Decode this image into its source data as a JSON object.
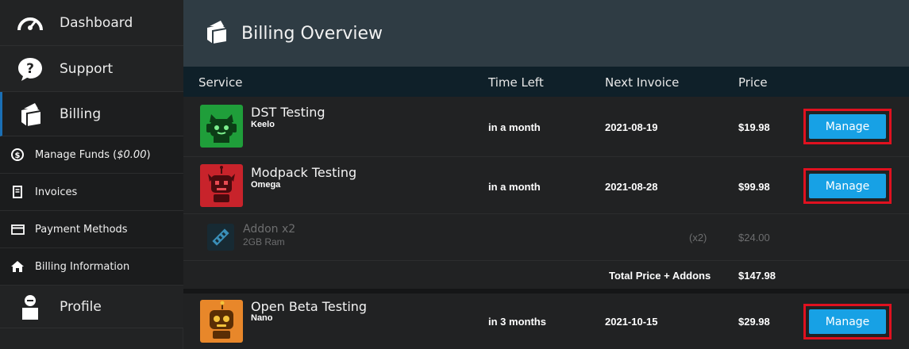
{
  "sidebar": {
    "dashboard": "Dashboard",
    "support": "Support",
    "billing": "Billing",
    "manage_funds": "Manage Funds (",
    "manage_funds_amount": "$0.00",
    "manage_funds_close": ")",
    "invoices": "Invoices",
    "payment_methods": "Payment Methods",
    "billing_information": "Billing Information",
    "profile": "Profile"
  },
  "header": {
    "title": "Billing Overview"
  },
  "table": {
    "columns": [
      "Service",
      "Time Left",
      "Next Invoice",
      "Price"
    ],
    "rows": [
      {
        "name": "DST Testing",
        "sub": "Keelo",
        "time_left": "in a month",
        "next_invoice": "2021-08-19",
        "price": "$19.98",
        "action": "Manage"
      },
      {
        "name": "Modpack Testing",
        "sub": "Omega",
        "time_left": "in a month",
        "next_invoice": "2021-08-28",
        "price": "$99.98",
        "action": "Manage"
      },
      {
        "name": "Open Beta Testing",
        "sub": "Nano",
        "time_left": "in 3 months",
        "next_invoice": "2021-10-15",
        "price": "$29.98",
        "action": "Manage"
      }
    ],
    "addon": {
      "name": "Addon x2",
      "sub": "2GB Ram",
      "qty": "(x2)",
      "price": "$24.00"
    },
    "total": {
      "label": "Total Price + Addons",
      "value": "$147.98"
    }
  },
  "colors": {
    "accent": "#17a1e5",
    "highlight": "#e0111f",
    "header_bg": "#2f3c44",
    "table_head_bg": "#0f2029"
  }
}
